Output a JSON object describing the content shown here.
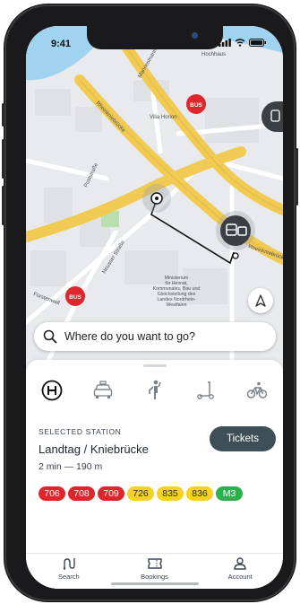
{
  "status_bar": {
    "time": "9:41"
  },
  "map": {
    "street_labels": [
      "Hochhaus",
      "Vilia Horion",
      "Rheinkniebrücke",
      "Mannesmannufer",
      "Fürstenwall",
      "Neusser Straße",
      "Rheinkniebrücke",
      "Poststraße"
    ],
    "building_label": [
      "Ministerium",
      "für Heimat,",
      "Kommunales, Bau und",
      "Gleichstellung des",
      "Landes Nordrhein-",
      "Westfalen"
    ],
    "bus_badge": "BUS",
    "marker_icons": [
      "bus-stop-icon",
      "tram-stop-icon",
      "station-icon"
    ]
  },
  "search": {
    "placeholder": "Where do you want to go?",
    "icon": "search-icon"
  },
  "modes": [
    {
      "name": "public-transport",
      "icon": "h-station-icon"
    },
    {
      "name": "taxi",
      "icon": "taxi-icon"
    },
    {
      "name": "walk",
      "icon": "walking-icon"
    },
    {
      "name": "e-scooter",
      "icon": "scooter-icon"
    },
    {
      "name": "bike",
      "icon": "bike-icon"
    }
  ],
  "selected_station": {
    "label": "SELECTED STATION",
    "name": "Landtag / Kniebrücke",
    "meta": "2 min — 190 m",
    "tickets_label": "Tickets"
  },
  "lines": [
    {
      "label": "706",
      "color": "#e0262d",
      "text": "#ffffff"
    },
    {
      "label": "708",
      "color": "#e0262d",
      "text": "#ffffff"
    },
    {
      "label": "709",
      "color": "#e0262d",
      "text": "#ffffff"
    },
    {
      "label": "726",
      "color": "#f4d21f",
      "text": "#1f2933"
    },
    {
      "label": "835",
      "color": "#f4d21f",
      "text": "#1f2933"
    },
    {
      "label": "836",
      "color": "#f4d21f",
      "text": "#1f2933"
    },
    {
      "label": "M3",
      "color": "#2bb24c",
      "text": "#ffffff"
    }
  ],
  "tabs": [
    {
      "label": "Search",
      "icon": "route-icon"
    },
    {
      "label": "Bookings",
      "icon": "ticket-icon"
    },
    {
      "label": "Account",
      "icon": "user-icon"
    }
  ],
  "colors": {
    "accent": "#3f4f58",
    "map_road": "#f2c94c",
    "map_bg": "#e8eaed",
    "water": "#9fd3f0"
  }
}
